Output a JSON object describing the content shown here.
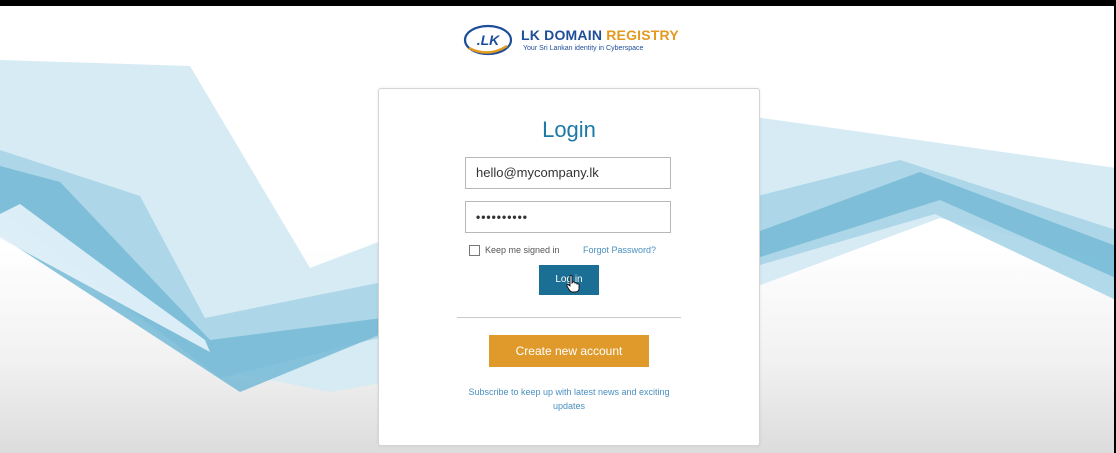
{
  "header": {
    "logo_mark": ".LK",
    "brand_name_primary": "LK DOMAIN",
    "brand_name_accent": "REGISTRY",
    "tagline": "Your Sri Lankan identity in Cyberspace"
  },
  "login": {
    "title": "Login",
    "email_value": "hello@mycompany.lk",
    "password_value": "••••••••••",
    "remember_label": "Keep me signed in",
    "remember_checked": false,
    "forgot_link": "Forgot Password?",
    "login_button": "Log in",
    "create_account_button": "Create new account",
    "subscribe_text": "Subscribe to keep up with latest news and exciting updates"
  },
  "colors": {
    "brand_blue": "#1f4e99",
    "brand_orange": "#e39a1f",
    "title_blue": "#1d7aa6",
    "login_button_bg": "#1b6f95",
    "create_button_bg": "#e09a2b",
    "wave_light": "#cfe6f1",
    "wave_mid": "#9ccfe3",
    "wave_dark": "#6cb3d1"
  },
  "icons": {
    "cursor": "hand-pointer-icon",
    "checkbox": "checkbox-icon"
  }
}
